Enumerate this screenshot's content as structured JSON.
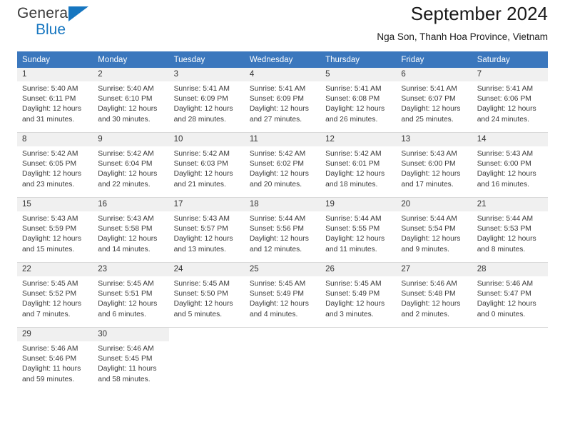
{
  "brand": {
    "name_part1": "General",
    "name_part2": "Blue",
    "triangle_icon": "triangle-icon",
    "accent_color": "#1676c0"
  },
  "header": {
    "title": "September 2024",
    "subtitle": "Nga Son, Thanh Hoa Province, Vietnam"
  },
  "calendar": {
    "header_bg": "#3b77bd",
    "header_text_color": "#ffffff",
    "daynum_bg": "#f0f0f0",
    "weekdays": [
      "Sunday",
      "Monday",
      "Tuesday",
      "Wednesday",
      "Thursday",
      "Friday",
      "Saturday"
    ],
    "weeks": [
      [
        {
          "day": "1",
          "sunrise": "Sunrise: 5:40 AM",
          "sunset": "Sunset: 6:11 PM",
          "daylight_line1": "Daylight: 12 hours",
          "daylight_line2": "and 31 minutes."
        },
        {
          "day": "2",
          "sunrise": "Sunrise: 5:40 AM",
          "sunset": "Sunset: 6:10 PM",
          "daylight_line1": "Daylight: 12 hours",
          "daylight_line2": "and 30 minutes."
        },
        {
          "day": "3",
          "sunrise": "Sunrise: 5:41 AM",
          "sunset": "Sunset: 6:09 PM",
          "daylight_line1": "Daylight: 12 hours",
          "daylight_line2": "and 28 minutes."
        },
        {
          "day": "4",
          "sunrise": "Sunrise: 5:41 AM",
          "sunset": "Sunset: 6:09 PM",
          "daylight_line1": "Daylight: 12 hours",
          "daylight_line2": "and 27 minutes."
        },
        {
          "day": "5",
          "sunrise": "Sunrise: 5:41 AM",
          "sunset": "Sunset: 6:08 PM",
          "daylight_line1": "Daylight: 12 hours",
          "daylight_line2": "and 26 minutes."
        },
        {
          "day": "6",
          "sunrise": "Sunrise: 5:41 AM",
          "sunset": "Sunset: 6:07 PM",
          "daylight_line1": "Daylight: 12 hours",
          "daylight_line2": "and 25 minutes."
        },
        {
          "day": "7",
          "sunrise": "Sunrise: 5:41 AM",
          "sunset": "Sunset: 6:06 PM",
          "daylight_line1": "Daylight: 12 hours",
          "daylight_line2": "and 24 minutes."
        }
      ],
      [
        {
          "day": "8",
          "sunrise": "Sunrise: 5:42 AM",
          "sunset": "Sunset: 6:05 PM",
          "daylight_line1": "Daylight: 12 hours",
          "daylight_line2": "and 23 minutes."
        },
        {
          "day": "9",
          "sunrise": "Sunrise: 5:42 AM",
          "sunset": "Sunset: 6:04 PM",
          "daylight_line1": "Daylight: 12 hours",
          "daylight_line2": "and 22 minutes."
        },
        {
          "day": "10",
          "sunrise": "Sunrise: 5:42 AM",
          "sunset": "Sunset: 6:03 PM",
          "daylight_line1": "Daylight: 12 hours",
          "daylight_line2": "and 21 minutes."
        },
        {
          "day": "11",
          "sunrise": "Sunrise: 5:42 AM",
          "sunset": "Sunset: 6:02 PM",
          "daylight_line1": "Daylight: 12 hours",
          "daylight_line2": "and 20 minutes."
        },
        {
          "day": "12",
          "sunrise": "Sunrise: 5:42 AM",
          "sunset": "Sunset: 6:01 PM",
          "daylight_line1": "Daylight: 12 hours",
          "daylight_line2": "and 18 minutes."
        },
        {
          "day": "13",
          "sunrise": "Sunrise: 5:43 AM",
          "sunset": "Sunset: 6:00 PM",
          "daylight_line1": "Daylight: 12 hours",
          "daylight_line2": "and 17 minutes."
        },
        {
          "day": "14",
          "sunrise": "Sunrise: 5:43 AM",
          "sunset": "Sunset: 6:00 PM",
          "daylight_line1": "Daylight: 12 hours",
          "daylight_line2": "and 16 minutes."
        }
      ],
      [
        {
          "day": "15",
          "sunrise": "Sunrise: 5:43 AM",
          "sunset": "Sunset: 5:59 PM",
          "daylight_line1": "Daylight: 12 hours",
          "daylight_line2": "and 15 minutes."
        },
        {
          "day": "16",
          "sunrise": "Sunrise: 5:43 AM",
          "sunset": "Sunset: 5:58 PM",
          "daylight_line1": "Daylight: 12 hours",
          "daylight_line2": "and 14 minutes."
        },
        {
          "day": "17",
          "sunrise": "Sunrise: 5:43 AM",
          "sunset": "Sunset: 5:57 PM",
          "daylight_line1": "Daylight: 12 hours",
          "daylight_line2": "and 13 minutes."
        },
        {
          "day": "18",
          "sunrise": "Sunrise: 5:44 AM",
          "sunset": "Sunset: 5:56 PM",
          "daylight_line1": "Daylight: 12 hours",
          "daylight_line2": "and 12 minutes."
        },
        {
          "day": "19",
          "sunrise": "Sunrise: 5:44 AM",
          "sunset": "Sunset: 5:55 PM",
          "daylight_line1": "Daylight: 12 hours",
          "daylight_line2": "and 11 minutes."
        },
        {
          "day": "20",
          "sunrise": "Sunrise: 5:44 AM",
          "sunset": "Sunset: 5:54 PM",
          "daylight_line1": "Daylight: 12 hours",
          "daylight_line2": "and 9 minutes."
        },
        {
          "day": "21",
          "sunrise": "Sunrise: 5:44 AM",
          "sunset": "Sunset: 5:53 PM",
          "daylight_line1": "Daylight: 12 hours",
          "daylight_line2": "and 8 minutes."
        }
      ],
      [
        {
          "day": "22",
          "sunrise": "Sunrise: 5:45 AM",
          "sunset": "Sunset: 5:52 PM",
          "daylight_line1": "Daylight: 12 hours",
          "daylight_line2": "and 7 minutes."
        },
        {
          "day": "23",
          "sunrise": "Sunrise: 5:45 AM",
          "sunset": "Sunset: 5:51 PM",
          "daylight_line1": "Daylight: 12 hours",
          "daylight_line2": "and 6 minutes."
        },
        {
          "day": "24",
          "sunrise": "Sunrise: 5:45 AM",
          "sunset": "Sunset: 5:50 PM",
          "daylight_line1": "Daylight: 12 hours",
          "daylight_line2": "and 5 minutes."
        },
        {
          "day": "25",
          "sunrise": "Sunrise: 5:45 AM",
          "sunset": "Sunset: 5:49 PM",
          "daylight_line1": "Daylight: 12 hours",
          "daylight_line2": "and 4 minutes."
        },
        {
          "day": "26",
          "sunrise": "Sunrise: 5:45 AM",
          "sunset": "Sunset: 5:49 PM",
          "daylight_line1": "Daylight: 12 hours",
          "daylight_line2": "and 3 minutes."
        },
        {
          "day": "27",
          "sunrise": "Sunrise: 5:46 AM",
          "sunset": "Sunset: 5:48 PM",
          "daylight_line1": "Daylight: 12 hours",
          "daylight_line2": "and 2 minutes."
        },
        {
          "day": "28",
          "sunrise": "Sunrise: 5:46 AM",
          "sunset": "Sunset: 5:47 PM",
          "daylight_line1": "Daylight: 12 hours",
          "daylight_line2": "and 0 minutes."
        }
      ],
      [
        {
          "day": "29",
          "sunrise": "Sunrise: 5:46 AM",
          "sunset": "Sunset: 5:46 PM",
          "daylight_line1": "Daylight: 11 hours",
          "daylight_line2": "and 59 minutes."
        },
        {
          "day": "30",
          "sunrise": "Sunrise: 5:46 AM",
          "sunset": "Sunset: 5:45 PM",
          "daylight_line1": "Daylight: 11 hours",
          "daylight_line2": "and 58 minutes."
        },
        {
          "day": "",
          "sunrise": "",
          "sunset": "",
          "daylight_line1": "",
          "daylight_line2": ""
        },
        {
          "day": "",
          "sunrise": "",
          "sunset": "",
          "daylight_line1": "",
          "daylight_line2": ""
        },
        {
          "day": "",
          "sunrise": "",
          "sunset": "",
          "daylight_line1": "",
          "daylight_line2": ""
        },
        {
          "day": "",
          "sunrise": "",
          "sunset": "",
          "daylight_line1": "",
          "daylight_line2": ""
        },
        {
          "day": "",
          "sunrise": "",
          "sunset": "",
          "daylight_line1": "",
          "daylight_line2": ""
        }
      ]
    ]
  }
}
